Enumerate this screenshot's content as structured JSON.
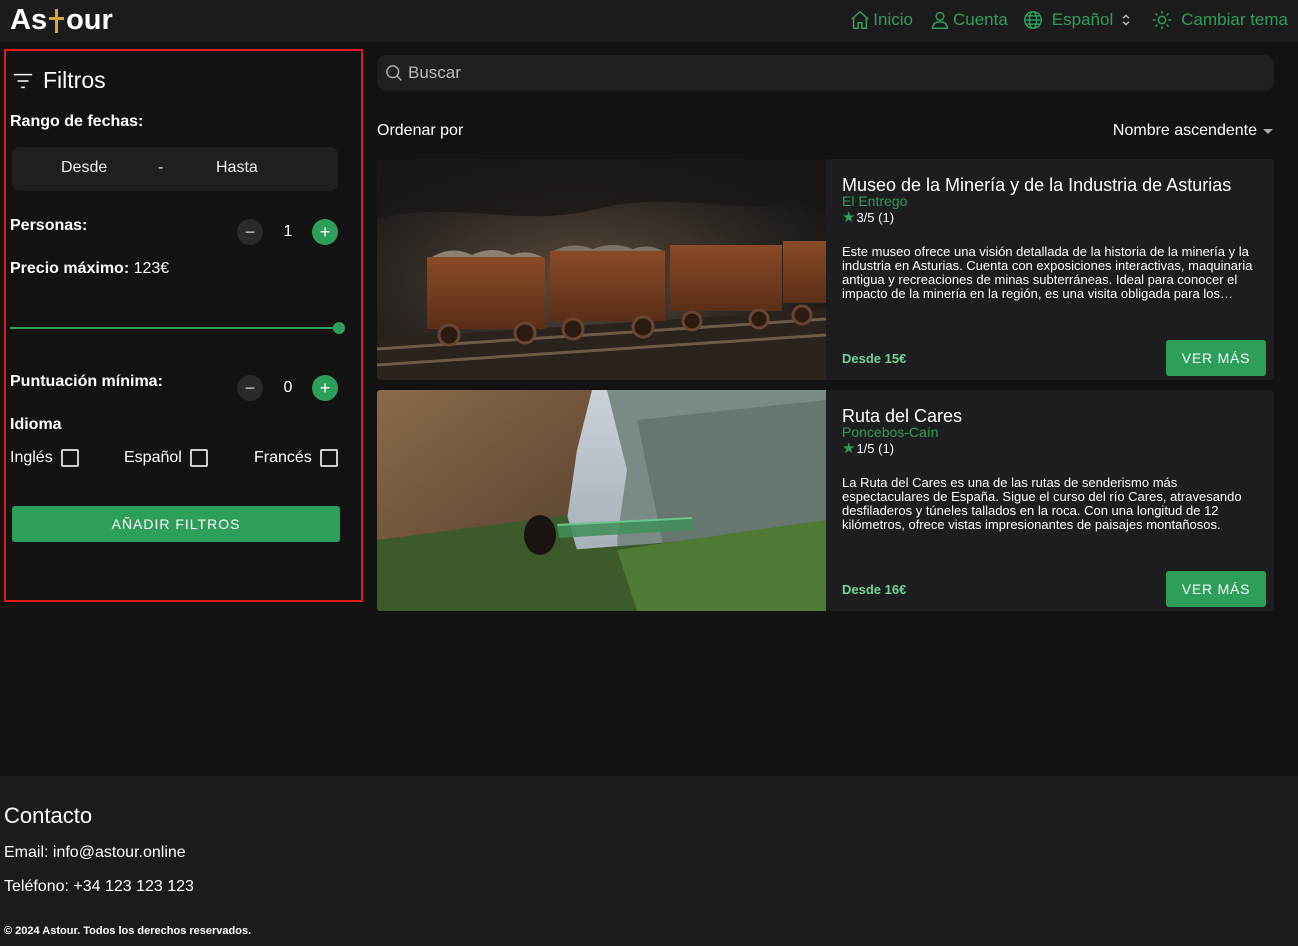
{
  "header": {
    "logo_text_before": "As",
    "logo_text_after": "our",
    "nav": {
      "home": "Inicio",
      "account": "Cuenta",
      "language": "Español",
      "theme": "Cambiar tema"
    }
  },
  "filters": {
    "title": "Filtros",
    "date_range_label": "Rango de fechas:",
    "date_from": "Desde",
    "date_separator": "-",
    "date_to": "Hasta",
    "persons_label": "Personas:",
    "persons_value": "1",
    "max_price_label": "Precio máximo:",
    "max_price_value": "123€",
    "max_price_slider_fraction": 1.0,
    "min_rating_label": "Puntuación mínima:",
    "min_rating_value": "0",
    "language_label": "Idioma",
    "languages": [
      {
        "label": "Inglés",
        "checked": false
      },
      {
        "label": "Español",
        "checked": false
      },
      {
        "label": "Francés",
        "checked": false
      }
    ],
    "apply_label": "AÑADIR FILTROS"
  },
  "search": {
    "placeholder": "Buscar"
  },
  "sort": {
    "label": "Ordenar por",
    "selected": "Nombre ascendente"
  },
  "tours": [
    {
      "title": "Museo de la Minería y de la Industria de Asturias",
      "location": "El Entrego",
      "rating": "3/5 (1)",
      "description": "Este museo ofrece una visión detallada de la historia de la minería y la industria en Asturias. Cuenta con exposiciones interactivas, maquinaria antigua y recreaciones de minas subterráneas. Ideal para conocer el impacto de la minería en la región, es una visita obligada para los amantes de la historia.",
      "price": "Desde 15€",
      "button": "VER MÁS"
    },
    {
      "title": "Ruta del Cares",
      "location": "Poncebos-Caín",
      "rating": "1/5 (1)",
      "description": "La Ruta del Cares es una de las rutas de senderismo más espectaculares de España. Sigue el curso del río Cares, atravesando desfiladeros y túneles tallados en la roca. Con una longitud de 12 kilómetros, ofrece vistas impresionantes de paisajes montañosos.",
      "price": "Desde 16€",
      "button": "VER MÁS"
    }
  ],
  "footer": {
    "contact_title": "Contacto",
    "email": "Email: info@astour.online",
    "phone": "Teléfono: +34 123 123 123",
    "copyright": "© 2024 Astour. Todos los derechos reservados."
  },
  "colors": {
    "accent": "#2e9e5b",
    "background": "#121213",
    "header_bg": "#1b1b1c",
    "card_bg": "#1d1d1f",
    "highlight_border": "#e01a1a"
  }
}
